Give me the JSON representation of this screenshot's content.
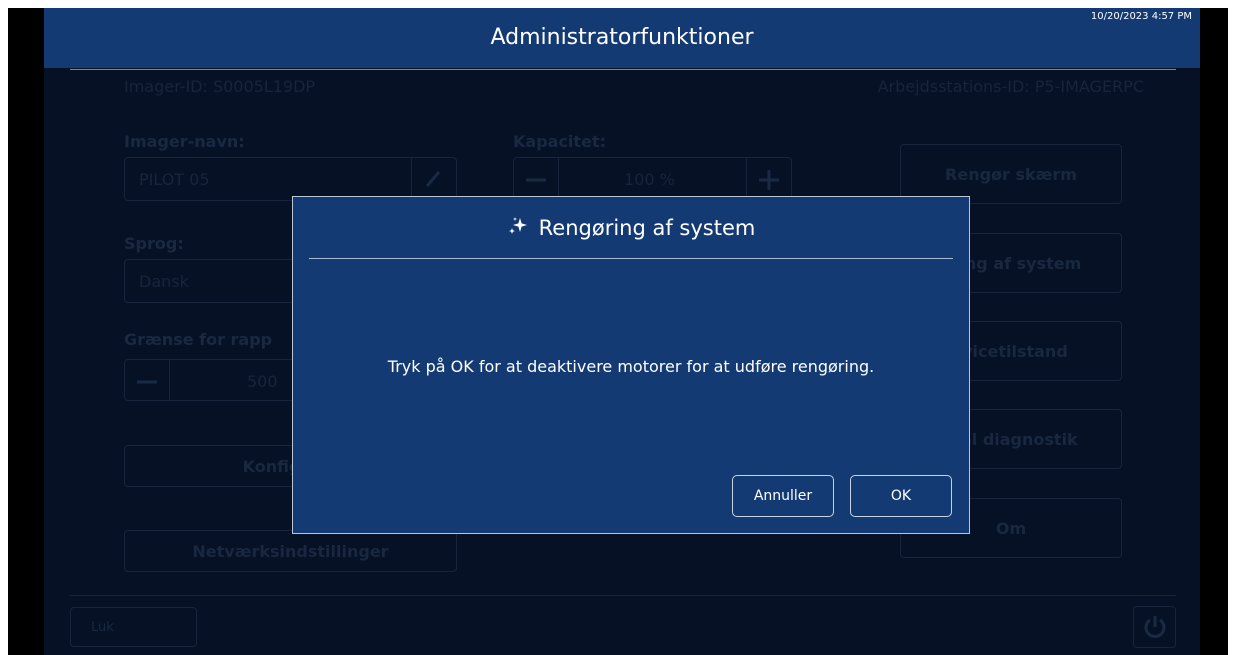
{
  "header": {
    "title": "Administratorfunktioner",
    "datetime": "10/20/2023 4:57 PM"
  },
  "info": {
    "imager_id": "Imager-ID: S0005L19DP",
    "workstation_id": "Arbejdsstations-ID: P5-IMAGERPC"
  },
  "form": {
    "imager_name_label": "Imager-navn:",
    "imager_name_value": "PILOT 05",
    "capacity_label": "Kapacitet:",
    "capacity_value": "100 %",
    "language_label": "Sprog:",
    "language_value": "Dansk",
    "report_limit_label": "Grænse for rapp",
    "report_limit_value": "500",
    "configure_label": "Konfigurer",
    "network_label": "Netværksindstillinger"
  },
  "side_buttons": {
    "clean_screen": "Rengør skærm",
    "system_clean": "ering af system",
    "service_mode": "rvicetilstand",
    "diagnostics": "aml diagnostik",
    "about": "Om"
  },
  "footer": {
    "close_label": "Luk"
  },
  "dialog": {
    "title": "Rengøring af system",
    "message": "Tryk på OK for at deaktivere motorer for at udføre rengøring.",
    "cancel_label": "Annuller",
    "ok_label": "OK"
  }
}
